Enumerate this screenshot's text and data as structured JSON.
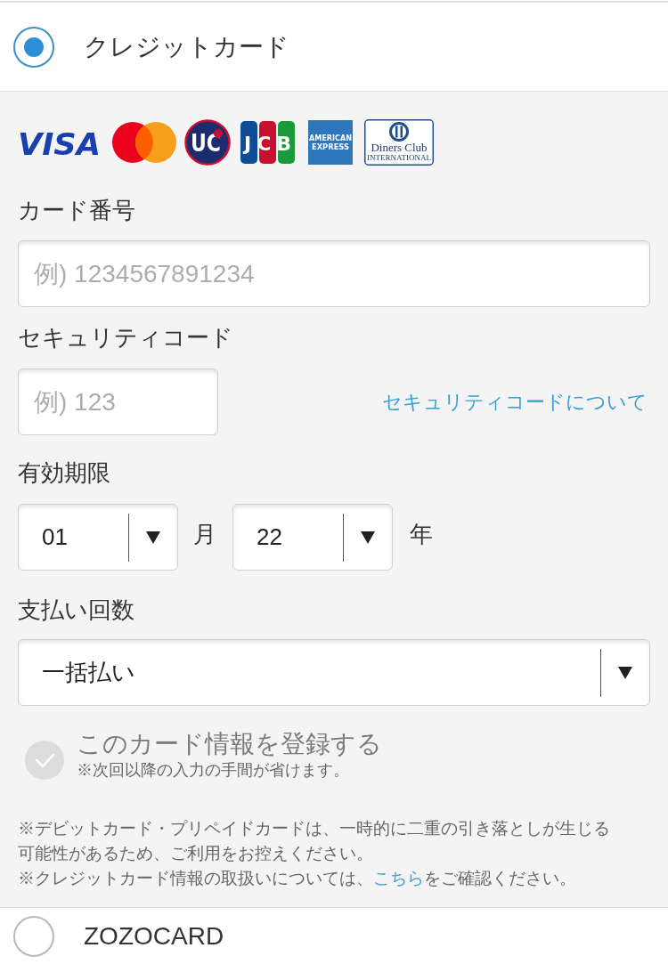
{
  "options": [
    {
      "label": "クレジットカード",
      "selected": true
    },
    {
      "label": "ZOZOCARD",
      "selected": false
    }
  ],
  "card_brands": [
    {
      "kind": "visa",
      "lines": [
        "VISA"
      ]
    },
    {
      "kind": "mastercard"
    },
    {
      "kind": "uc",
      "lines": [
        "UC"
      ]
    },
    {
      "kind": "jcb",
      "lines": [
        "JCB"
      ]
    },
    {
      "kind": "amex",
      "lines": [
        "AMERICAN",
        "EXPRESS"
      ]
    },
    {
      "kind": "diners",
      "lines": [
        "Diners Club",
        "INTERNATIONAL"
      ]
    }
  ],
  "card_number": {
    "label": "カード番号",
    "placeholder": "例) 1234567891234"
  },
  "security_code": {
    "label": "セキュリティコード",
    "placeholder": "例) 123",
    "help_link": "セキュリティコードについて"
  },
  "expiry": {
    "label": "有効期限",
    "month": {
      "value": "01",
      "unit": "月"
    },
    "year": {
      "value": "22",
      "unit": "年"
    }
  },
  "installments": {
    "label": "支払い回数",
    "value": "一括払い"
  },
  "save_card": {
    "label": "このカード情報を登録する",
    "note": "※次回以降の入力の手間が省けます。",
    "checked": false
  },
  "notes": [
    {
      "text": "※デビットカード・プリペイドカードは、一時的に二重の引き落としが生じる可能性があるため、ご利用をお控えください。"
    },
    {
      "before": "※クレジットカード情報の取扱いについては、",
      "link": "こちら",
      "after": "をご確認ください。"
    }
  ]
}
